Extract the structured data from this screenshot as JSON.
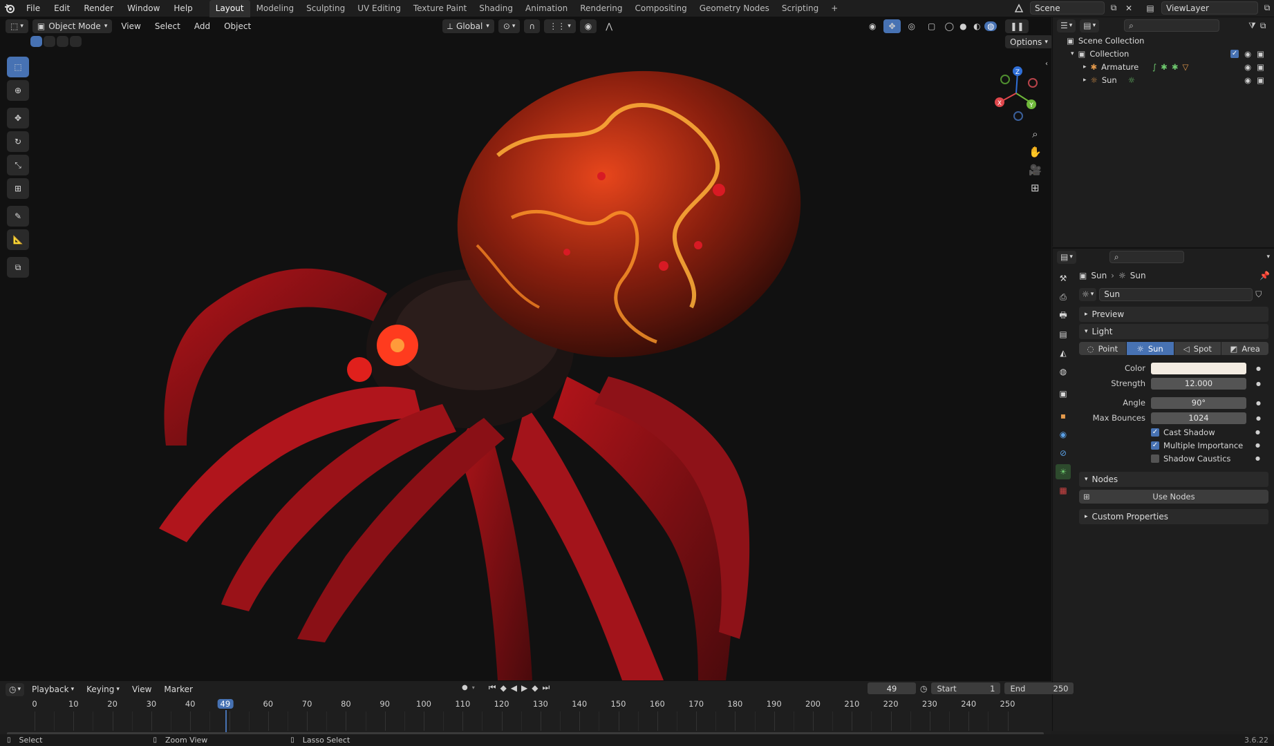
{
  "app": {
    "name": "Blender",
    "version": "3.6.22"
  },
  "menus": [
    "File",
    "Edit",
    "Render",
    "Window",
    "Help"
  ],
  "workspaces": [
    "Layout",
    "Modeling",
    "Sculpting",
    "UV Editing",
    "Texture Paint",
    "Shading",
    "Animation",
    "Rendering",
    "Compositing",
    "Geometry Nodes",
    "Scripting"
  ],
  "active_workspace": "Layout",
  "scene_name": "Scene",
  "view_layer": "ViewLayer",
  "viewport": {
    "mode": "Object Mode",
    "header_menus": [
      "View",
      "Select",
      "Add",
      "Object"
    ],
    "orientation": "Global",
    "options_label": "Options",
    "gizmo_axes": {
      "x": "X",
      "y": "Y",
      "z": "Z"
    }
  },
  "outliner": {
    "root": "Scene Collection",
    "collection": "Collection",
    "items": [
      {
        "name": "Armature"
      },
      {
        "name": "Sun"
      }
    ]
  },
  "properties": {
    "breadcrumb": [
      "Sun",
      "Sun"
    ],
    "datablock_name": "Sun",
    "panels": {
      "preview": "Preview",
      "light": "Light",
      "nodes": "Nodes",
      "custom": "Custom Properties"
    },
    "light_types": [
      "Point",
      "Sun",
      "Spot",
      "Area"
    ],
    "active_light_type": "Sun",
    "fields": {
      "color_label": "Color",
      "color_value": "#f3ece2",
      "strength_label": "Strength",
      "strength_value": "12.000",
      "angle_label": "Angle",
      "angle_value": "90°",
      "bounces_label": "Max Bounces",
      "bounces_value": "1024"
    },
    "checkboxes": [
      {
        "label": "Cast Shadow",
        "checked": true
      },
      {
        "label": "Multiple Importance",
        "checked": true
      },
      {
        "label": "Shadow Caustics",
        "checked": false
      }
    ],
    "use_nodes_label": "Use Nodes"
  },
  "timeline": {
    "menus": [
      "Playback",
      "Keying",
      "View",
      "Marker"
    ],
    "current_frame": "49",
    "start_label": "Start",
    "start_value": "1",
    "end_label": "End",
    "end_value": "250",
    "ticks": [
      "0",
      "10",
      "20",
      "30",
      "40",
      "49",
      "60",
      "70",
      "80",
      "90",
      "100",
      "110",
      "120",
      "130",
      "140",
      "150",
      "160",
      "170",
      "180",
      "190",
      "200",
      "210",
      "220",
      "230",
      "240",
      "250"
    ]
  },
  "statusbar": {
    "items": [
      "Select",
      "Zoom View",
      "Lasso Select"
    ],
    "version": "3.6.22"
  },
  "colors": {
    "accent": "#4772b3",
    "panel": "#1e1e1e",
    "viewport_bg": "#111111"
  }
}
